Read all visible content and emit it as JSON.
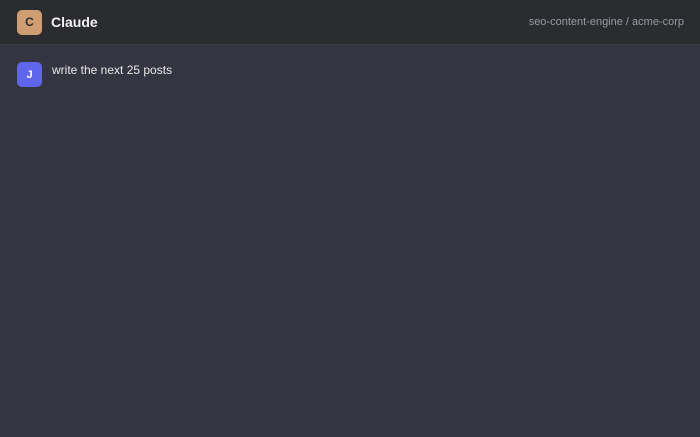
{
  "header": {
    "avatar_letter": "C",
    "title": "Claude",
    "workspace_path": "seo-content-engine / acme-corp"
  },
  "messages": [
    {
      "role": "user",
      "avatar_letter": "J",
      "text": "write the next 25 posts"
    }
  ],
  "colors": {
    "background": "#353541",
    "header_background": "#2b2c30",
    "brand_avatar": "#cf9d72",
    "user_avatar": "#5f66ec"
  }
}
